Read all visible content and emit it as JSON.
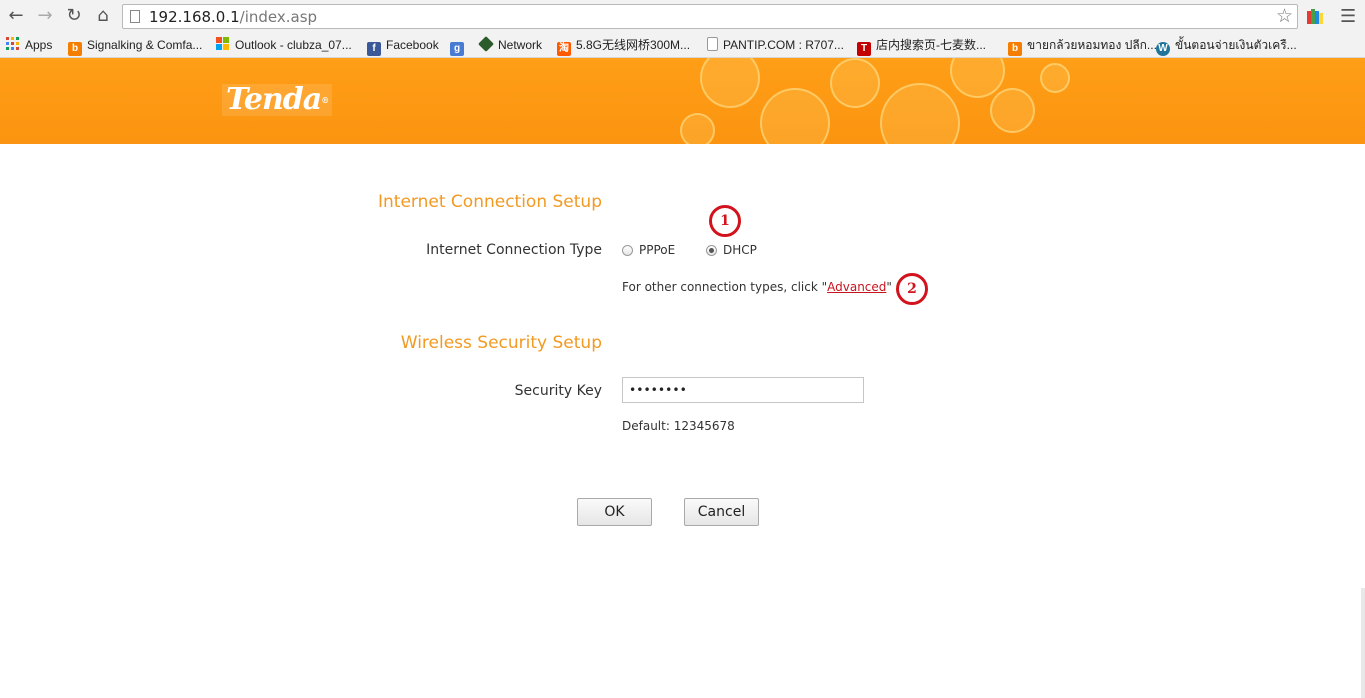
{
  "browser": {
    "url_host": "192.168.0.1",
    "url_path": "/index.asp",
    "bookmarks": [
      {
        "label": "Apps",
        "icon": "apps-grid-icon",
        "color": "#d34836"
      },
      {
        "label": "Signalking & Comfa...",
        "icon": "blogger-icon",
        "color": "#f57d00"
      },
      {
        "label": "Outlook - clubza_07...",
        "icon": "windows-icon",
        "color": "#0078d7"
      },
      {
        "label": "Facebook",
        "icon": "facebook-icon",
        "color": "#3b5998"
      },
      {
        "label": "",
        "icon": "google-icon",
        "color": "#4a7bd3"
      },
      {
        "label": "Network",
        "icon": "network-icon",
        "color": "#2b5a2b"
      },
      {
        "label": "5.8G无线网桥300M...",
        "icon": "shop-icon",
        "color": "#ff5a00"
      },
      {
        "label": "PANTIP.COM : R707...",
        "icon": "page-icon",
        "color": "#ffffff"
      },
      {
        "label": "店内搜索页-七麦数...",
        "icon": "tmall-icon",
        "color": "#c40000"
      },
      {
        "label": "ขายกล้วยหอมทอง ปลีก...",
        "icon": "blogger-icon",
        "color": "#f57d00"
      },
      {
        "label": "ขั้นตอนจ่ายเงินตัวเครื...",
        "icon": "wordpress-icon",
        "color": "#21759b"
      }
    ]
  },
  "brand": {
    "logo_text": "Tenda",
    "logo_mark": "®",
    "accent": "#fb9410",
    "title_color": "#f29a22"
  },
  "internet": {
    "title": "Internet Connection Setup",
    "type_label": "Internet Connection Type",
    "options": [
      {
        "label": "PPPoE",
        "checked": false
      },
      {
        "label": "DHCP",
        "checked": true
      }
    ],
    "hint_prefix": "For other connection types, click \"",
    "hint_link": "Advanced",
    "hint_suffix": "\""
  },
  "wireless": {
    "title": "Wireless Security Setup",
    "key_label": "Security Key",
    "key_value": "••••••••",
    "default_text": "Default: 12345678"
  },
  "buttons": {
    "ok": "OK",
    "cancel": "Cancel"
  },
  "annotations": {
    "marker1": "1",
    "marker2": "2",
    "color": "#d2121c"
  }
}
